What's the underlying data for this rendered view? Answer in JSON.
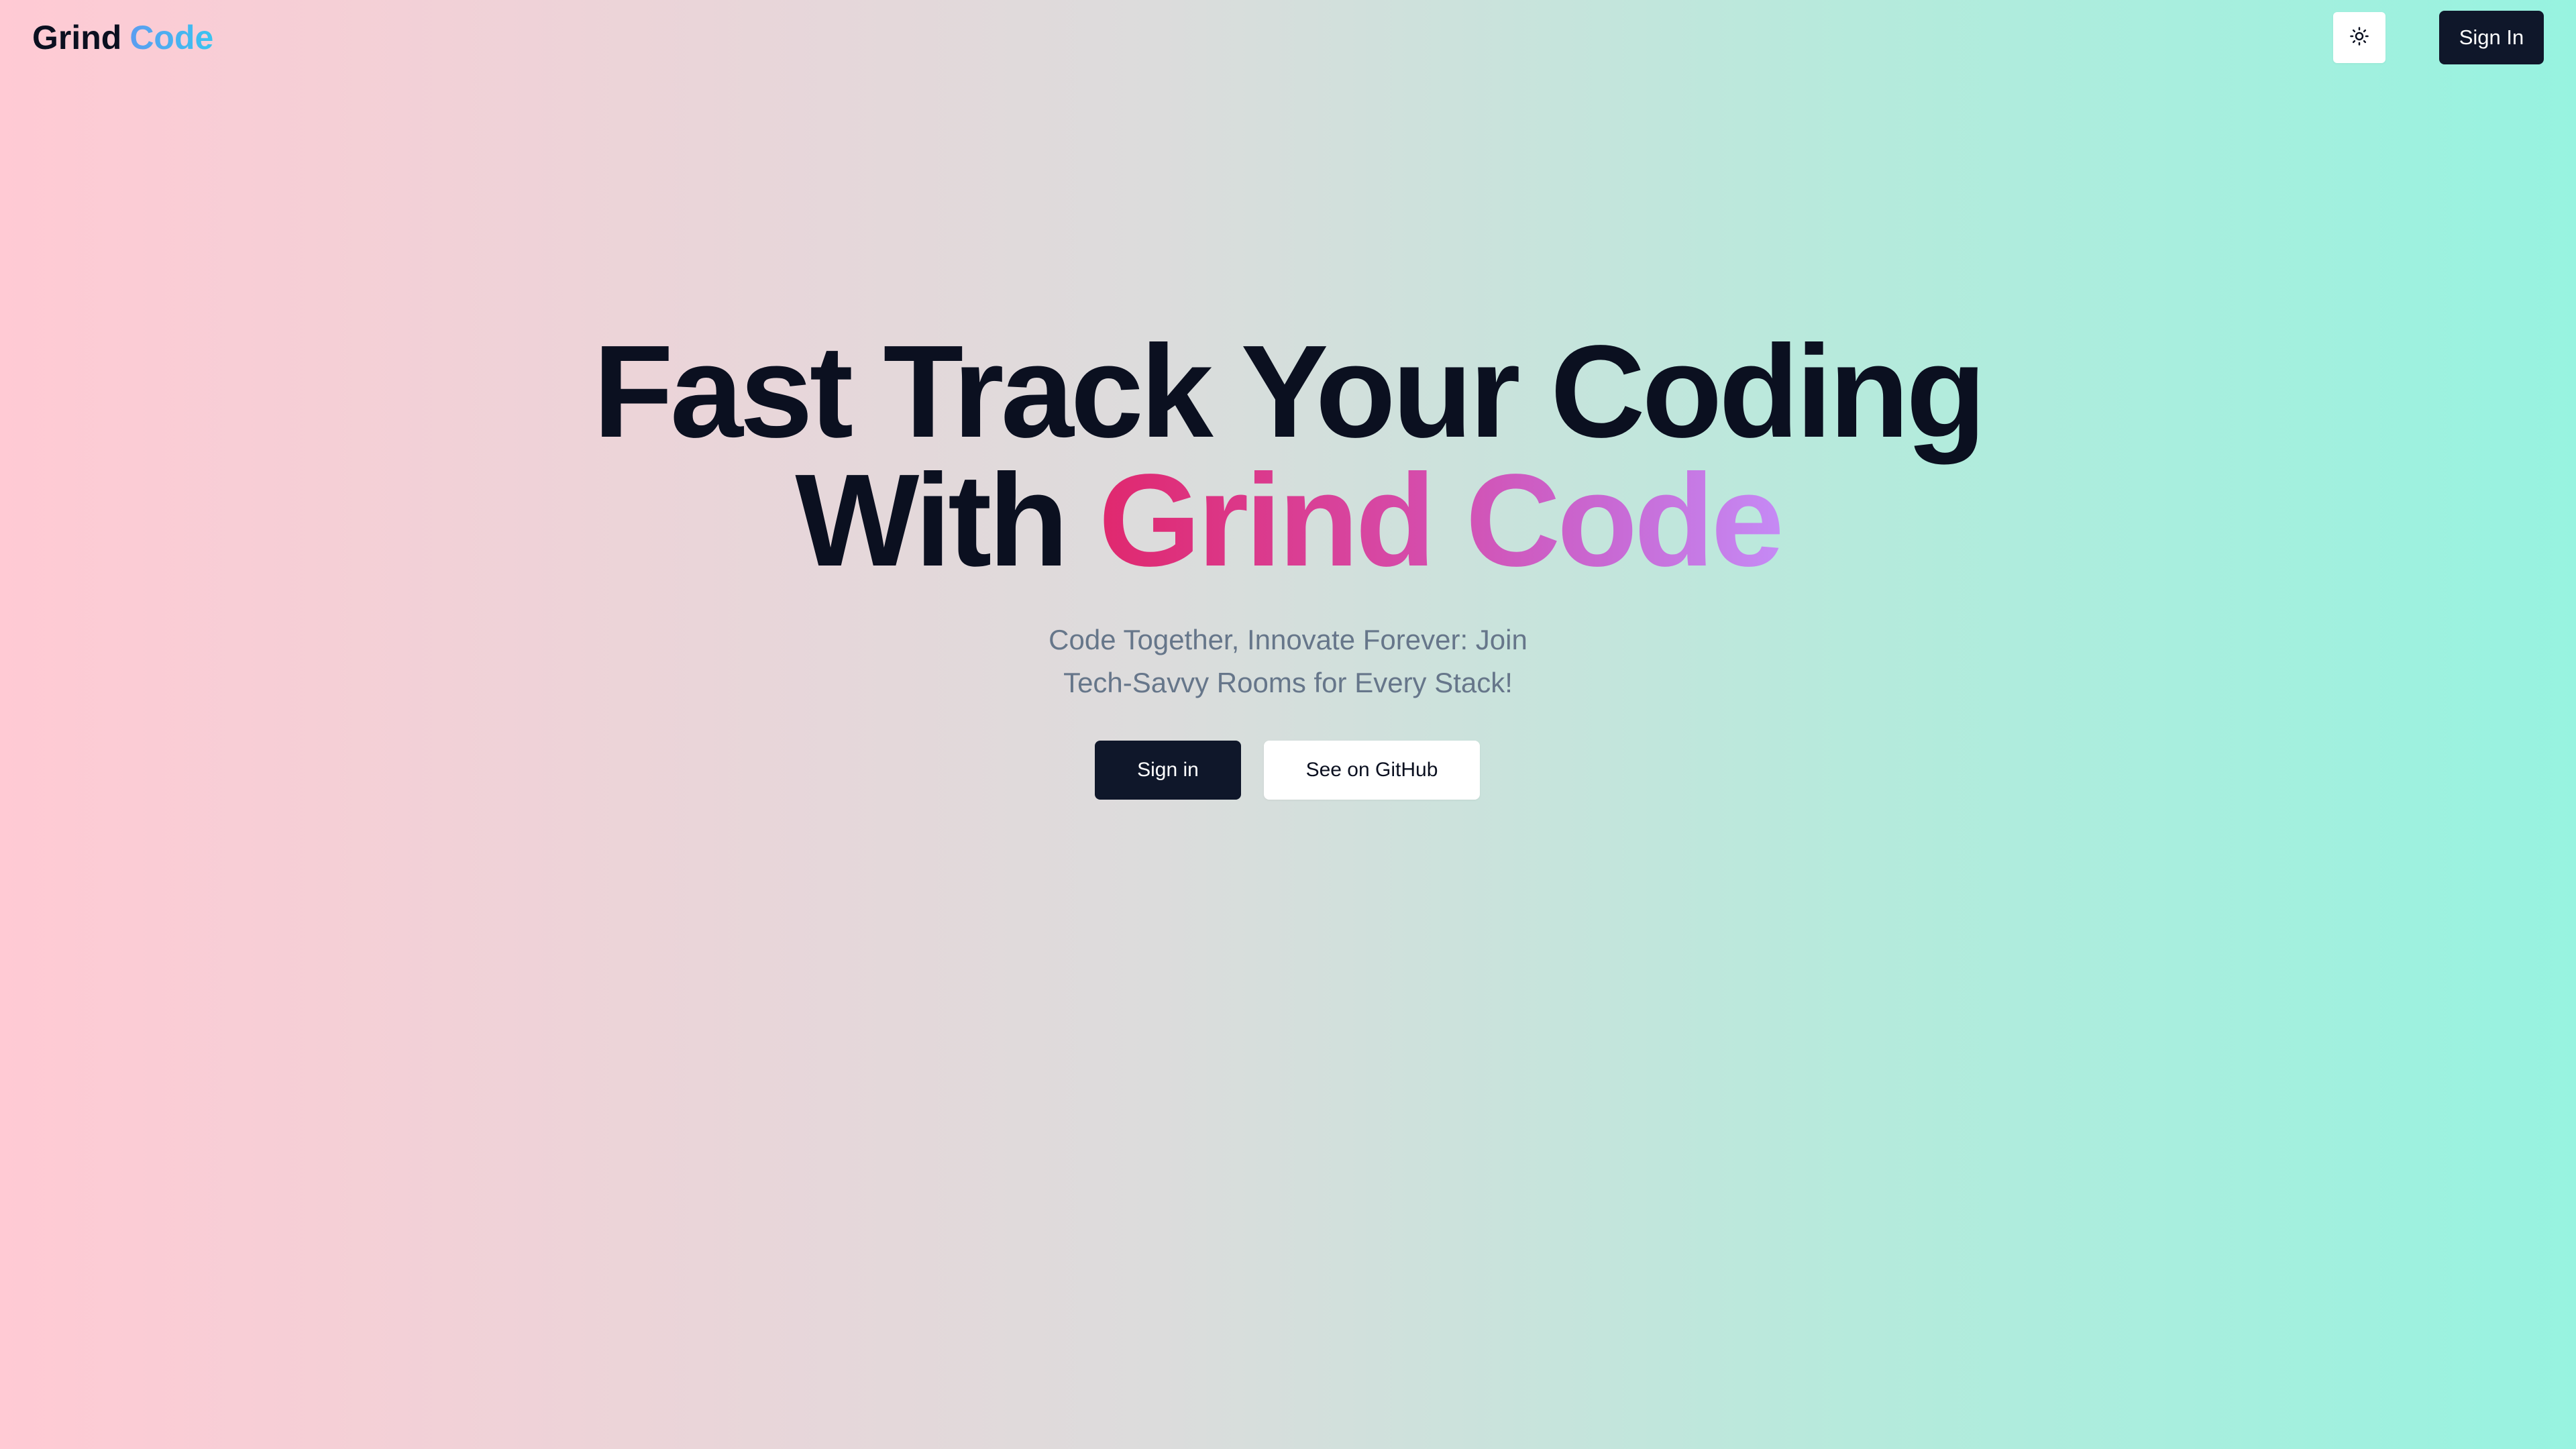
{
  "header": {
    "logo_part1": "Grind",
    "logo_part2": "Code",
    "theme_icon": "sun-icon",
    "signin_label": "Sign In"
  },
  "hero": {
    "title_line1": "Fast Track Your Coding",
    "title_line2_prefix": "With",
    "title_line2_accent": "Grind Code",
    "subtitle_line1": "Code Together, Innovate Forever: Join",
    "subtitle_line2": "Tech-Savvy Rooms for Every Stack!"
  },
  "actions": {
    "primary_label": "Sign in",
    "secondary_label": "See on GitHub"
  },
  "colors": {
    "dark": "#0f172a",
    "subtitle": "#66768a",
    "accent_start": "#e0286e",
    "accent_end": "#c58af5",
    "bg_left": "#ffcad4",
    "bg_right": "#97f3e0"
  }
}
